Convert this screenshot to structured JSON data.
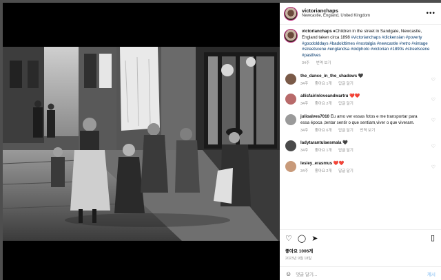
{
  "post": {
    "username": "victorianchaps",
    "location": "Newcastle, England, United Kingdom",
    "more_label": "•••"
  },
  "caption": {
    "username": "victorianchaps",
    "text_pre": "♦Children in the street in Sandgate, Newcastle, England taken circa 1898",
    "hashtags": "#victorianchaps #dickensian #poverty #goodolddays #badoldtimes #nostalgia #newcastle #retro #vintage #streetscene #englandsa #oldphoto #victorian #1890s #streetscene #pastlives",
    "time": "34주",
    "translate": "번역 보기"
  },
  "comments": [
    {
      "username": "the_dance_in_the_shadows",
      "text": "🖤",
      "time": "34주",
      "likes": "좋아요 1개",
      "reply": "답글 달기",
      "translate": ""
    },
    {
      "username": "allisfairinloveandwartru",
      "text": "❤️❤️",
      "time": "34주",
      "likes": "좋아요 2개",
      "reply": "답글 달기",
      "translate": ""
    },
    {
      "username": "julioalves7010",
      "text": "Eu amo ver essas fotos e me transportar para essa época ,tentar sentir o que sentiam,viver o que viveram.",
      "time": "34주",
      "likes": "좋아요 6개",
      "reply": "답글 달기",
      "translate": "번역 보기"
    },
    {
      "username": "ladytarantulaesmala",
      "text": "🖤",
      "time": "34주",
      "likes": "좋아요 1개",
      "reply": "답글 달기",
      "translate": ""
    },
    {
      "username": "lesley_erasmus",
      "text": "❤️❤️",
      "time": "34주",
      "likes": "좋아요 2개",
      "reply": "답글 달기",
      "translate": ""
    }
  ],
  "footer": {
    "likes": "좋아요 1006개",
    "date": "2023년 9월 18일",
    "add_comment_placeholder": "댓글 달기...",
    "post_label": "게시"
  }
}
